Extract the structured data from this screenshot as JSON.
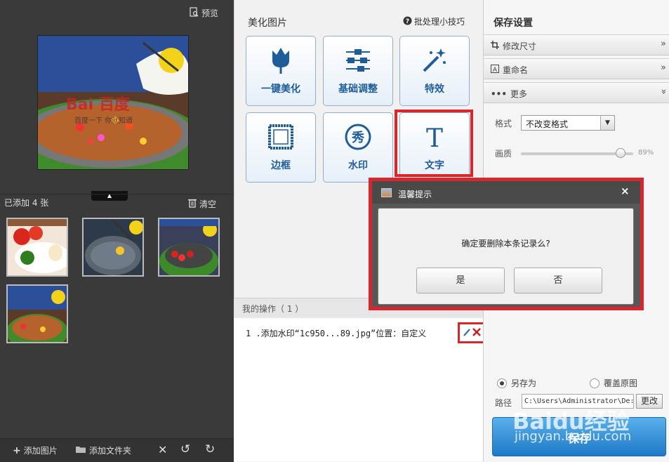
{
  "left_panel": {
    "preview_label": "预览",
    "added_count": "已添加 4 张",
    "clear_label": "清空",
    "bottom": {
      "add_image": "添加图片",
      "add_folder": "添加文件夹"
    },
    "preview_watermark": "百度一下 你就知道"
  },
  "center_panel": {
    "title": "美化图片",
    "tips": "批处理小技巧",
    "tools": [
      {
        "label": "一键美化",
        "icon": "tulip-icon"
      },
      {
        "label": "基础调整",
        "icon": "sliders-icon"
      },
      {
        "label": "特效",
        "icon": "magic-wand-icon"
      },
      {
        "label": "边框",
        "icon": "frame-icon"
      },
      {
        "label": "水印",
        "icon": "watermark-icon",
        "glyph": "秀"
      },
      {
        "label": "文字",
        "icon": "text-icon",
        "glyph": "T"
      }
    ],
    "ops_title": "我的操作（ 1 ）",
    "ops": [
      "1 .添加水印“1c950...89.jpg”位置：自定义"
    ]
  },
  "right_panel": {
    "title": "保存设置",
    "sections": [
      {
        "label": "修改尺寸",
        "chevron": "»"
      },
      {
        "label": "重命名",
        "chevron": "»"
      },
      {
        "label": "更多",
        "chevron": "»"
      }
    ],
    "format_label": "格式",
    "format_value": "不改变格式",
    "quality_label": "画质",
    "quality_value": "89%",
    "quality_fraction": 0.89,
    "save_as": "另存为",
    "overwrite": "覆盖原图",
    "path_label": "路径",
    "path_value": "C:\\Users\\Administrator\\De:",
    "change_btn": "更改",
    "save_btn": "保存"
  },
  "dialog": {
    "title": "温馨提示",
    "close": "×",
    "message": "确定要删除本条记录么?",
    "yes": "是",
    "no": "否"
  },
  "watermark": {
    "line1": "Baidu经验",
    "line2": "jingyan.baidu.com"
  },
  "colors": {
    "highlight": "#d9262b",
    "tool_label": "#1f5d99",
    "save_button": "#2a86d6"
  }
}
